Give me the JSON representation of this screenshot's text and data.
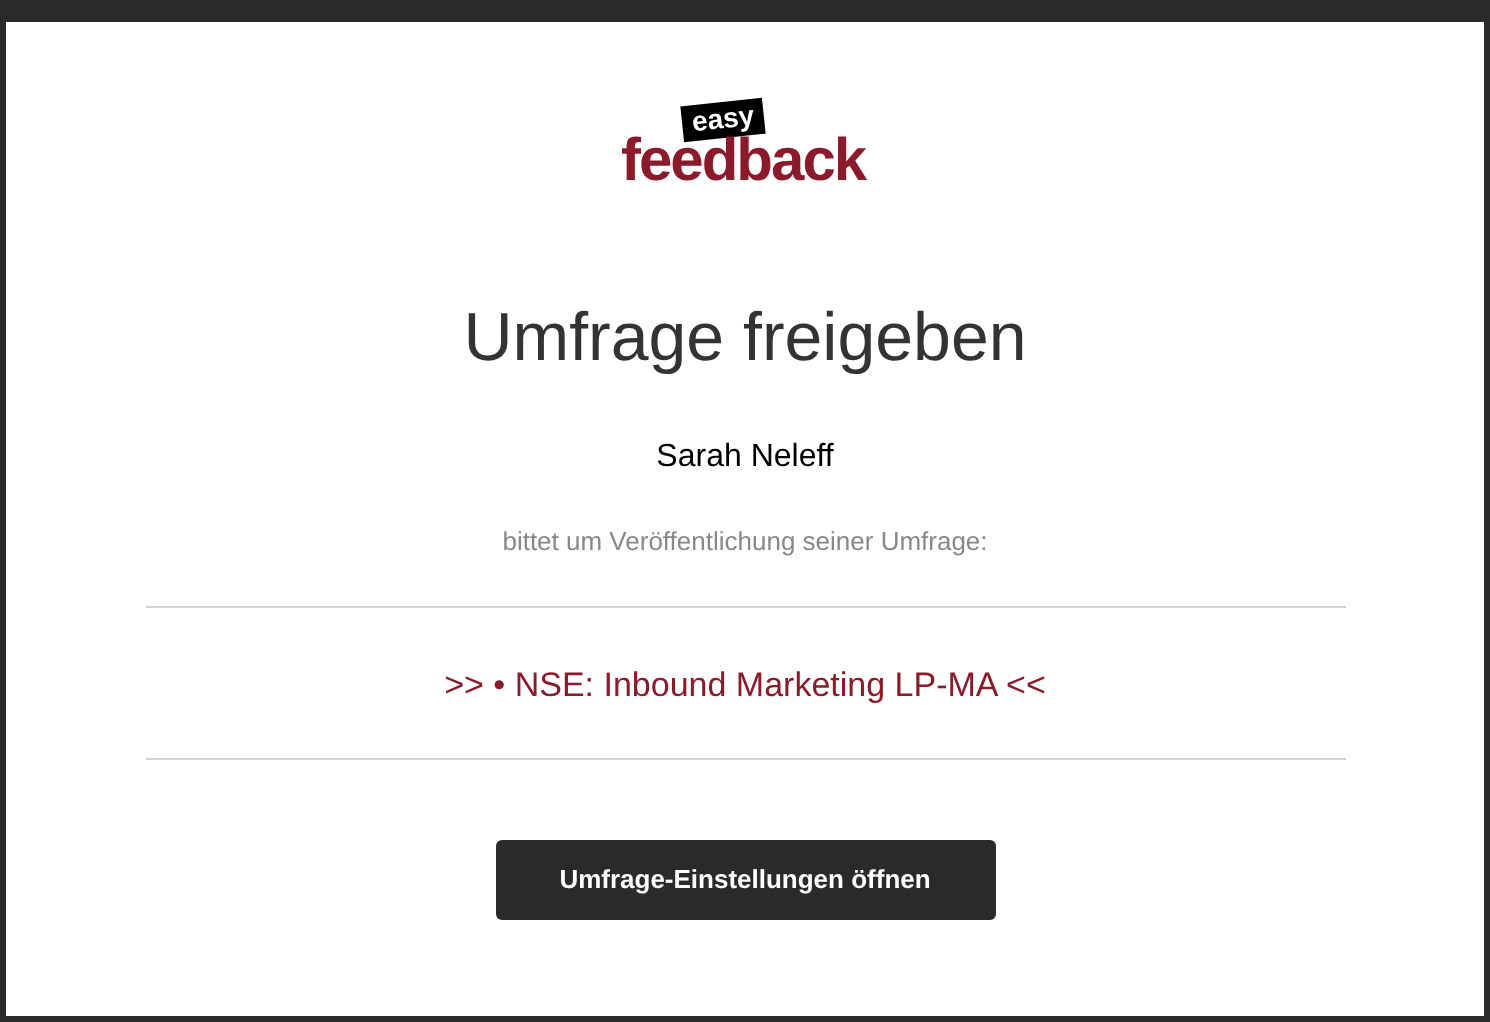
{
  "logo": {
    "badge": "easy",
    "wordmark": "feedback"
  },
  "title": "Umfrage freigeben",
  "requester": "Sarah Neleff",
  "message": "bittet um Veröffentlichung seiner Umfrage:",
  "survey_link": ">> • NSE: Inbound Marketing LP-MA <<",
  "button": "Umfrage-Einstellungen öffnen"
}
